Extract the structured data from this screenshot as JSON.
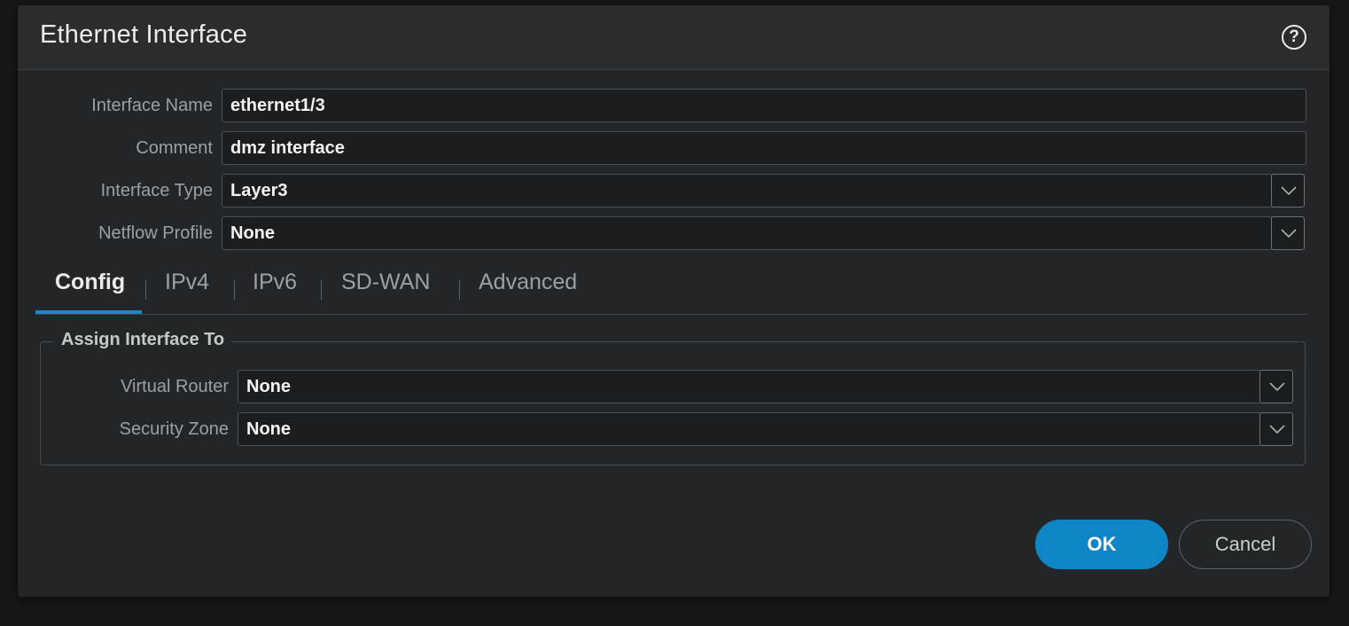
{
  "dialog": {
    "title": "Ethernet Interface",
    "help_icon": "?"
  },
  "fields": {
    "interface_name": {
      "label": "Interface Name",
      "value": "ethernet1/3"
    },
    "comment": {
      "label": "Comment",
      "value": "dmz interface"
    },
    "interface_type": {
      "label": "Interface Type",
      "value": "Layer3"
    },
    "netflow_profile": {
      "label": "Netflow Profile",
      "value": "None"
    }
  },
  "tabs": [
    {
      "label": "Config",
      "active": true
    },
    {
      "label": "IPv4",
      "active": false
    },
    {
      "label": "IPv6",
      "active": false
    },
    {
      "label": "SD-WAN",
      "active": false
    },
    {
      "label": "Advanced",
      "active": false
    }
  ],
  "assign": {
    "legend": "Assign Interface To",
    "virtual_router": {
      "label": "Virtual Router",
      "value": "None"
    },
    "security_zone": {
      "label": "Security Zone",
      "value": "None"
    }
  },
  "buttons": {
    "ok": "OK",
    "cancel": "Cancel"
  },
  "colors": {
    "accent": "#1d88c4",
    "ok_button": "#0e86c6",
    "dialog_bg": "#232628"
  },
  "icons": {
    "help": "help-circle-icon",
    "dropdown": "chevron-down-icon"
  }
}
